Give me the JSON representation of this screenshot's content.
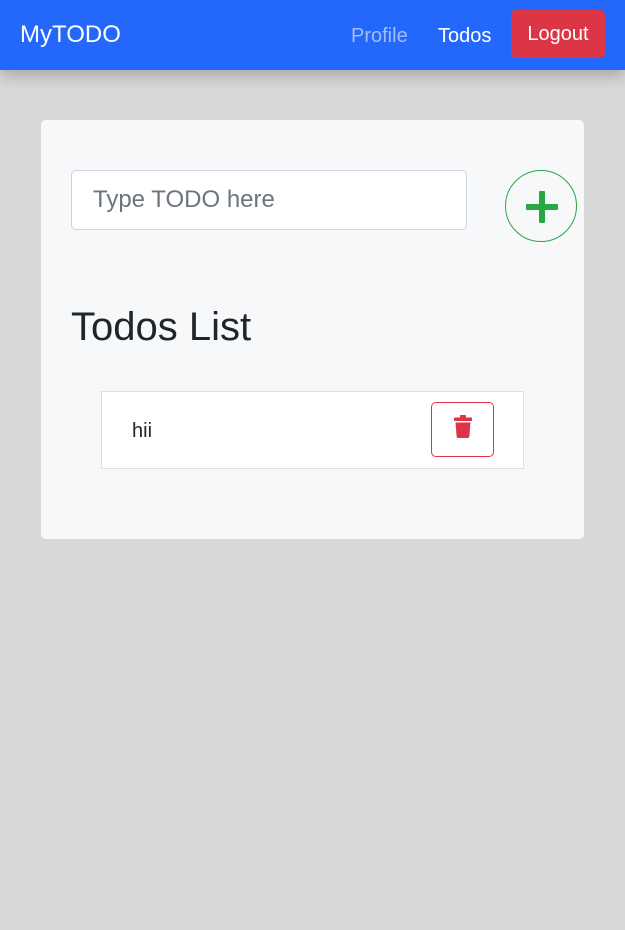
{
  "navbar": {
    "brand": "MyTODO",
    "links": [
      {
        "label": "Profile",
        "state": "muted"
      },
      {
        "label": "Todos",
        "state": "active"
      }
    ],
    "logout_label": "Logout",
    "background_color": "#2468fb",
    "logout_color": "#dc3545"
  },
  "todo_form": {
    "input_value": "",
    "input_placeholder": "Type TODO here",
    "add_icon": "plus-icon",
    "add_color": "#28a745"
  },
  "todos": {
    "title": "Todos List",
    "items": [
      {
        "text": "hii",
        "delete_icon": "trash-icon"
      }
    ]
  }
}
